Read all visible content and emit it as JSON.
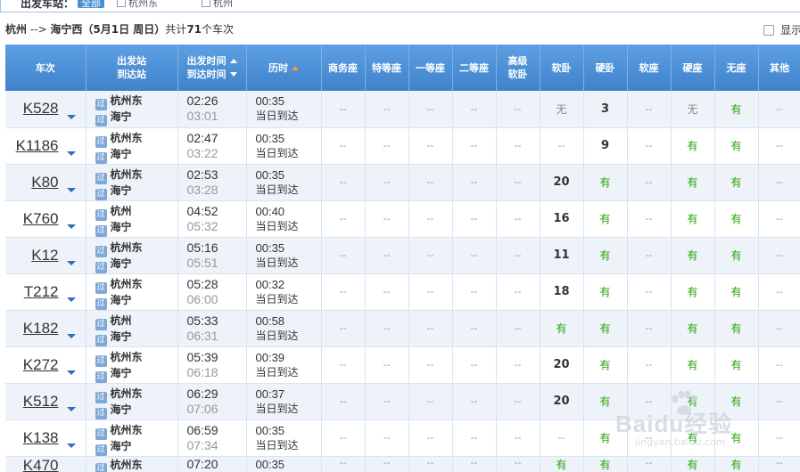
{
  "filter": {
    "label": "出发车站：",
    "badge": "全部",
    "options": [
      "杭州东",
      "杭州"
    ]
  },
  "summary": {
    "from": "杭州",
    "arrow": "-->",
    "to": "海宁西",
    "date": "（5月1日 周日）",
    "count_prefix": "共计",
    "count": "71",
    "count_suffix": "个车次"
  },
  "show_option_label": "显示",
  "headers": {
    "train": "车次",
    "station_dep": "出发站",
    "station_arr": "到达站",
    "time_dep": "出发时间",
    "time_arr": "到达时间",
    "duration": "历时",
    "seats": [
      "商务座",
      "特等座",
      "一等座",
      "二等座",
      "高级",
      "软卧",
      "硬卧",
      "软座",
      "硬座",
      "无座",
      "其他"
    ],
    "seat_high_line2": "软卧"
  },
  "station_icon": "过",
  "rows": [
    {
      "train": "K528",
      "from": "杭州东",
      "to": "海宁",
      "dep": "02:26",
      "arr": "03:01",
      "dur": "00:35",
      "note": "当日到达",
      "seats": [
        "--",
        "--",
        "--",
        "--",
        "--",
        "无",
        "3",
        "--",
        "无",
        "有",
        "--"
      ]
    },
    {
      "train": "K1186",
      "from": "杭州东",
      "to": "海宁",
      "dep": "02:47",
      "arr": "03:22",
      "dur": "00:35",
      "note": "当日到达",
      "seats": [
        "--",
        "--",
        "--",
        "--",
        "--",
        "--",
        "9",
        "--",
        "有",
        "有",
        "--"
      ]
    },
    {
      "train": "K80",
      "from": "杭州东",
      "to": "海宁",
      "dep": "02:53",
      "arr": "03:28",
      "dur": "00:35",
      "note": "当日到达",
      "seats": [
        "--",
        "--",
        "--",
        "--",
        "--",
        "20",
        "有",
        "--",
        "有",
        "有",
        "--"
      ]
    },
    {
      "train": "K760",
      "from": "杭州",
      "to": "海宁",
      "dep": "04:52",
      "arr": "05:32",
      "dur": "00:40",
      "note": "当日到达",
      "seats": [
        "--",
        "--",
        "--",
        "--",
        "--",
        "16",
        "有",
        "--",
        "有",
        "有",
        "--"
      ]
    },
    {
      "train": "K12",
      "from": "杭州东",
      "to": "海宁",
      "dep": "05:16",
      "arr": "05:51",
      "dur": "00:35",
      "note": "当日到达",
      "seats": [
        "--",
        "--",
        "--",
        "--",
        "--",
        "11",
        "有",
        "--",
        "有",
        "有",
        "--"
      ]
    },
    {
      "train": "T212",
      "from": "杭州东",
      "to": "海宁",
      "dep": "05:28",
      "arr": "06:00",
      "dur": "00:32",
      "note": "当日到达",
      "seats": [
        "--",
        "--",
        "--",
        "--",
        "--",
        "18",
        "有",
        "--",
        "有",
        "有",
        "--"
      ]
    },
    {
      "train": "K182",
      "from": "杭州",
      "to": "海宁",
      "dep": "05:33",
      "arr": "06:31",
      "dur": "00:58",
      "note": "当日到达",
      "seats": [
        "--",
        "--",
        "--",
        "--",
        "--",
        "有",
        "有",
        "--",
        "有",
        "有",
        "--"
      ]
    },
    {
      "train": "K272",
      "from": "杭州东",
      "to": "海宁",
      "dep": "05:39",
      "arr": "06:18",
      "dur": "00:39",
      "note": "当日到达",
      "seats": [
        "--",
        "--",
        "--",
        "--",
        "--",
        "20",
        "有",
        "--",
        "有",
        "有",
        "--"
      ]
    },
    {
      "train": "K512",
      "from": "杭州东",
      "to": "海宁",
      "dep": "06:29",
      "arr": "07:06",
      "dur": "00:37",
      "note": "当日到达",
      "seats": [
        "--",
        "--",
        "--",
        "--",
        "--",
        "20",
        "有",
        "--",
        "有",
        "有",
        "--"
      ]
    },
    {
      "train": "K138",
      "from": "杭州东",
      "to": "海宁",
      "dep": "06:59",
      "arr": "07:34",
      "dur": "00:35",
      "note": "当日到达",
      "seats": [
        "--",
        "--",
        "--",
        "--",
        "--",
        "--",
        "有",
        "--",
        "有",
        "有",
        "--"
      ]
    },
    {
      "train": "K470",
      "from": "杭州东",
      "to": "海宁",
      "dep": "07:20",
      "arr": "",
      "dur": "00:35",
      "note": "",
      "seats": [
        "--",
        "--",
        "--",
        "--",
        "--",
        "有",
        "有",
        "--",
        "有",
        "有",
        "--"
      ]
    }
  ],
  "watermark": {
    "text": "Baidu经验",
    "sub": "jingyan.baidu.com"
  },
  "colors": {
    "header_blue": "#4d90d6",
    "available_green": "#26a306",
    "row_alt": "#eef3fa"
  }
}
